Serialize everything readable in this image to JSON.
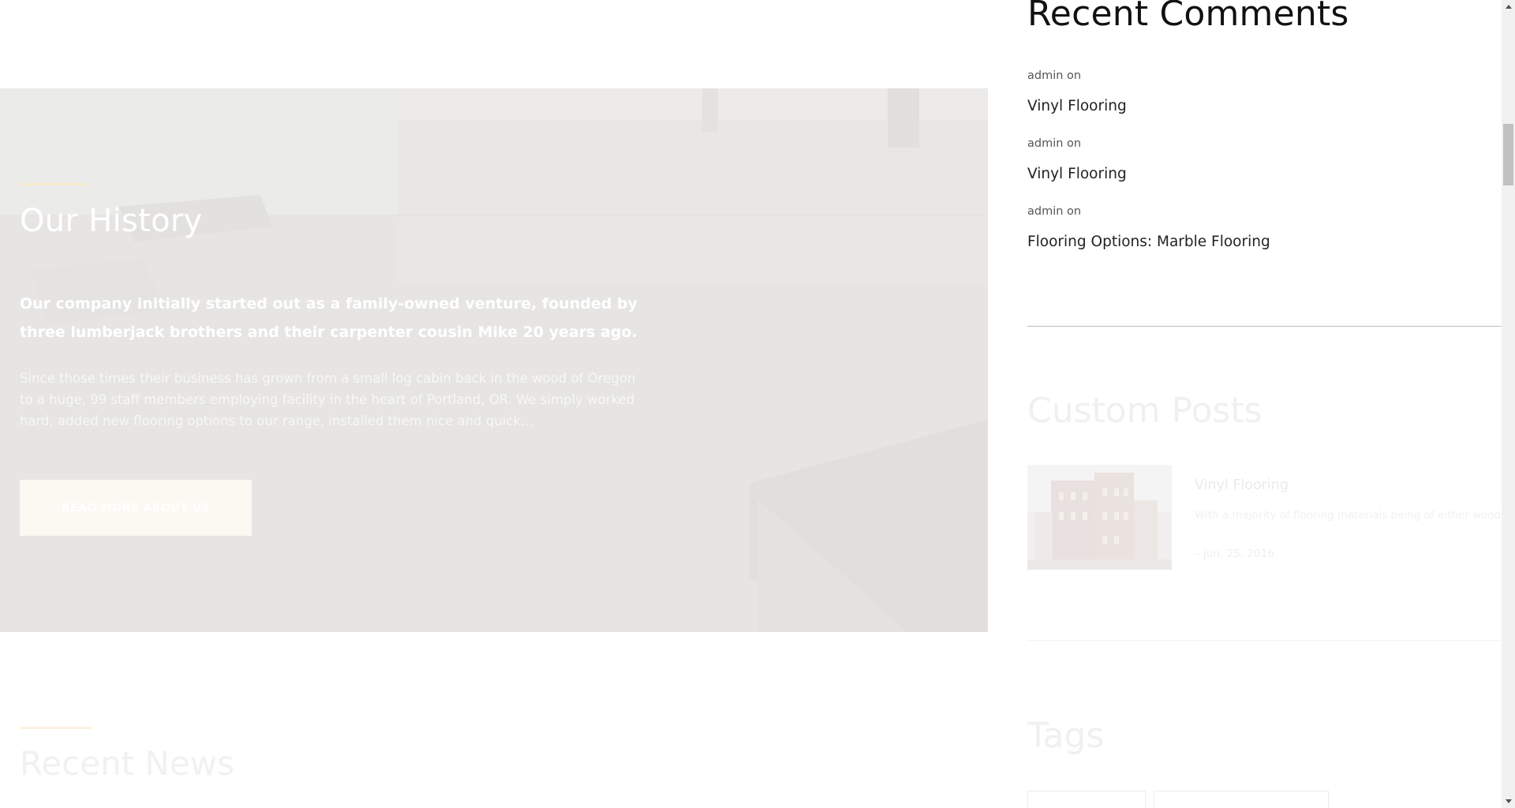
{
  "colors": {
    "accent_line": "#f6eccd",
    "hero_overlay": "#e7e6e4",
    "button_bg": "#fcf8f2",
    "heading_dark": "#111111",
    "faded_heading": "#f0f0f0"
  },
  "hero": {
    "title": "Our History",
    "lead": "Our company initially started out as a family-owned venture, founded by three lumberjack brothers and their carpenter cousin Mike 20 years ago.",
    "body": "Since those times their business has grown from a small log cabin back in the wood of Oregon to a huge, 99 staff members employing facility in the heart of Portland, OR. We simply worked hard, added new flooring options to our range, installed them nice and quick...",
    "button_label": "Read more about us"
  },
  "recent_news": {
    "title": "Recent News"
  },
  "sidebar": {
    "recent_comments": {
      "title": "Recent Comments",
      "items": [
        {
          "author": "admin on",
          "post": "Vinyl Flooring"
        },
        {
          "author": "admin on",
          "post": "Vinyl Flooring"
        },
        {
          "author": "admin on",
          "post": "Flooring Options: Marble Flooring"
        }
      ]
    },
    "custom_posts": {
      "title": "Custom Posts",
      "post": {
        "title": "Vinyl Flooring",
        "excerpt": "With a majority of flooring materials being of either wood,",
        "date": "– Jun. 25, 2016",
        "thumbnail_icon": "building-thumbnail"
      }
    },
    "tags": {
      "title": "Tags"
    }
  },
  "scrollbar": {
    "up_icon": "triangle-up-icon",
    "down_icon": "triangle-down-icon"
  }
}
